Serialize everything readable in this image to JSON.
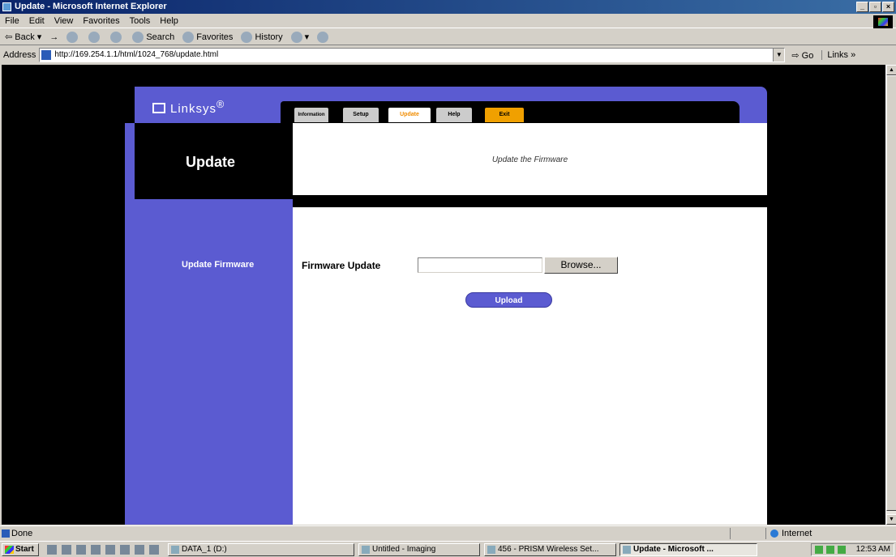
{
  "window": {
    "title": "Update - Microsoft Internet Explorer",
    "buttons": [
      "_",
      "▫",
      "×"
    ]
  },
  "menu": [
    "File",
    "Edit",
    "View",
    "Favorites",
    "Tools",
    "Help"
  ],
  "toolbar": {
    "back": "Back",
    "forward": "→",
    "search": "Search",
    "favorites": "Favorites",
    "history": "History"
  },
  "address": {
    "label": "Address",
    "url": "http://169.254.1.1/html/1024_768/update.html",
    "go": "Go",
    "links": "Links »"
  },
  "linksys": {
    "logo": "Linksys",
    "tabs": {
      "information": "Information",
      "setup": "Setup",
      "update": "Update",
      "help": "Help",
      "exit": "Exit"
    },
    "section_title": "Update",
    "section_subtitle": "Update the Firmware",
    "side_label": "Update Firmware",
    "field_label": "Firmware Update",
    "file_value": "",
    "browse": "Browse...",
    "upload": "Upload"
  },
  "status": {
    "text": "Done",
    "zone": "Internet"
  },
  "taskbar": {
    "start": "Start",
    "tasks": [
      {
        "label": "DATA_1 (D:)"
      },
      {
        "label": "Untitled - Imaging"
      },
      {
        "label": "456 - PRISM Wireless Set..."
      },
      {
        "label": "Update - Microsoft ..."
      }
    ],
    "clock": "12:53 AM"
  },
  "colors": {
    "linksys_purple": "#5b5bd1",
    "exit_tab": "#f0a000",
    "active_tab_text": "#f08c00"
  }
}
